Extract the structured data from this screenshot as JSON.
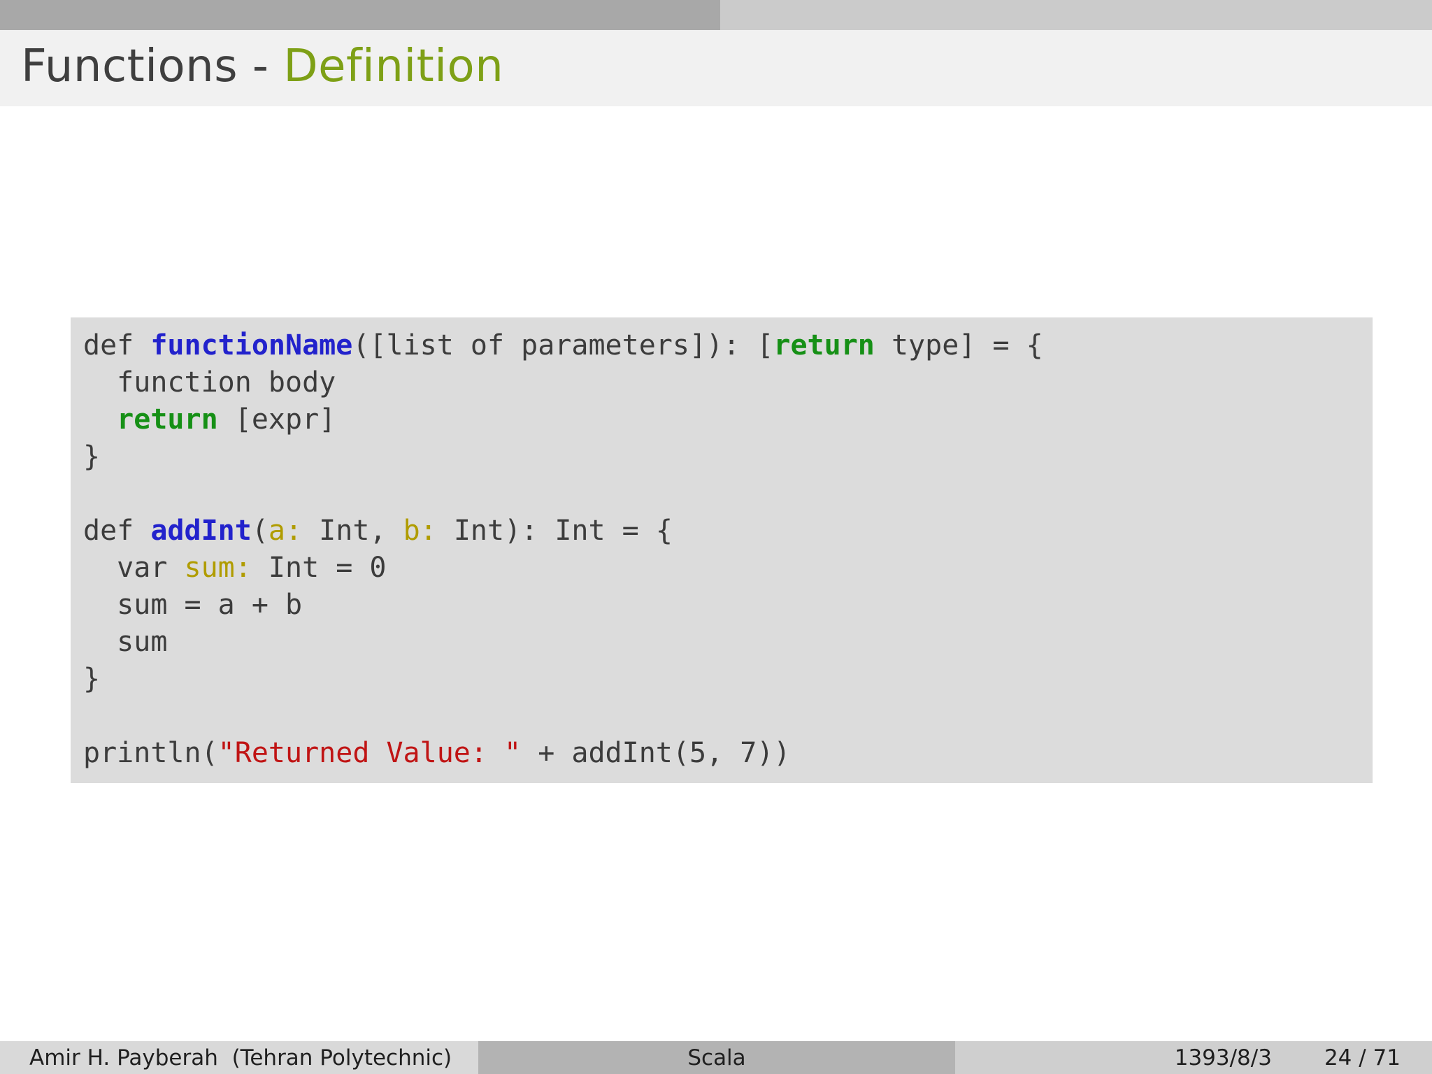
{
  "header": {
    "title_main": "Functions - ",
    "title_accent": "Definition"
  },
  "code": {
    "lines": [
      [
        {
          "t": "def ",
          "s": "p"
        },
        {
          "t": "functionName",
          "s": "fn"
        },
        {
          "t": "([list of parameters]): [",
          "s": "p"
        },
        {
          "t": "return",
          "s": "kw"
        },
        {
          "t": " type] = {",
          "s": "p"
        }
      ],
      [
        {
          "t": "  function body",
          "s": "p"
        }
      ],
      [
        {
          "t": "  ",
          "s": "p"
        },
        {
          "t": "return",
          "s": "kw"
        },
        {
          "t": " [expr]",
          "s": "p"
        }
      ],
      [
        {
          "t": "}",
          "s": "p"
        }
      ],
      [],
      [
        {
          "t": "def ",
          "s": "p"
        },
        {
          "t": "addInt",
          "s": "fn"
        },
        {
          "t": "(",
          "s": "p"
        },
        {
          "t": "a:",
          "s": "pr"
        },
        {
          "t": " Int, ",
          "s": "p"
        },
        {
          "t": "b:",
          "s": "pr"
        },
        {
          "t": " Int): Int = {",
          "s": "p"
        }
      ],
      [
        {
          "t": "  var ",
          "s": "p"
        },
        {
          "t": "sum:",
          "s": "pr"
        },
        {
          "t": " Int = 0",
          "s": "p"
        }
      ],
      [
        {
          "t": "  sum = a + b",
          "s": "p"
        }
      ],
      [
        {
          "t": "  sum",
          "s": "p"
        }
      ],
      [
        {
          "t": "}",
          "s": "p"
        }
      ],
      [],
      [
        {
          "t": "println(",
          "s": "p"
        },
        {
          "t": "\"Returned Value: \"",
          "s": "str"
        },
        {
          "t": " + addInt(5, 7))",
          "s": "p"
        }
      ]
    ]
  },
  "footer": {
    "author": "Amir H. Payberah  (Tehran Polytechnic)",
    "deck_title": "Scala",
    "date": "1393/8/3",
    "page": "24 / 71"
  },
  "colors": {
    "title_text": "#3f3f3f",
    "title_accent": "#7ea016",
    "titlebar_bg": "#f1f1f1",
    "topbar_left": "#a8a8a8",
    "topbar_right": "#cbcbcb",
    "code_bg": "#dcdcdc",
    "code_text": "#3c3c3c",
    "code_blue": "#2222cc",
    "code_green": "#169016",
    "code_olive": "#b09c00",
    "code_red": "#c01414",
    "footer_left_bg": "#d9d9d9",
    "footer_mid_bg": "#b3b3b3",
    "footer_right_bg": "#cfcfcf"
  }
}
